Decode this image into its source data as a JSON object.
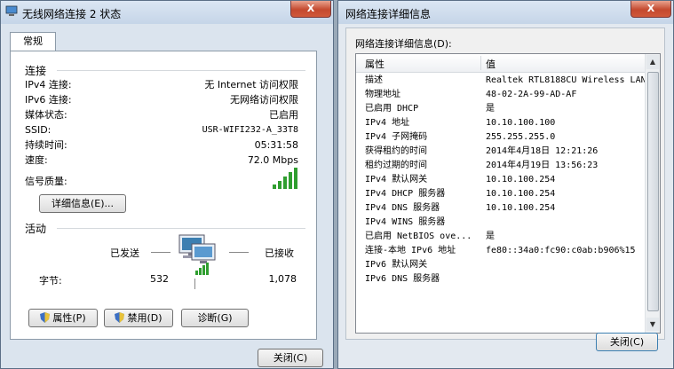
{
  "left_window": {
    "title": "无线网络连接 2 状态",
    "close_label": "X",
    "tab_label": "常规",
    "connection_heading": "连接",
    "connection_rows": [
      {
        "label": "IPv4 连接:",
        "value": "无 Internet 访问权限"
      },
      {
        "label": "IPv6 连接:",
        "value": "无网络访问权限"
      },
      {
        "label": "媒体状态:",
        "value": "已启用"
      },
      {
        "label": "SSID:",
        "value": "USR-WIFI232-A_33T8"
      },
      {
        "label": "持续时间:",
        "value": "05:31:58"
      },
      {
        "label": "速度:",
        "value": "72.0 Mbps"
      }
    ],
    "signal_label": "信号质量:",
    "signal_bars_lit": 5,
    "signal_bars_total": 5,
    "details_button": "详细信息(E)...",
    "activity_heading": "活动",
    "sent_label": "已发送",
    "received_label": "已接收",
    "bytes_label": "字节:",
    "bytes_sent": "532",
    "bytes_received": "1,078",
    "properties_button": "属性(P)",
    "disable_button": "禁用(D)",
    "diagnose_button": "诊断(G)",
    "close_button": "关闭(C)"
  },
  "right_window": {
    "title": "网络连接详细信息",
    "close_label": "X",
    "list_label": "网络连接详细信息(D):",
    "col_property": "属性",
    "col_value": "值",
    "rows": [
      {
        "prop": "描述",
        "value": "Realtek RTL8188CU Wireless LAN"
      },
      {
        "prop": "物理地址",
        "value": "48-02-2A-99-AD-AF"
      },
      {
        "prop": "已启用 DHCP",
        "value": "是"
      },
      {
        "prop": "IPv4 地址",
        "value": "10.10.100.100"
      },
      {
        "prop": "IPv4 子网掩码",
        "value": "255.255.255.0"
      },
      {
        "prop": "获得租约的时间",
        "value": "2014年4月18日 12:21:26"
      },
      {
        "prop": "租约过期的时间",
        "value": "2014年4月19日 13:56:23"
      },
      {
        "prop": "IPv4 默认网关",
        "value": "10.10.100.254"
      },
      {
        "prop": "IPv4 DHCP 服务器",
        "value": "10.10.100.254"
      },
      {
        "prop": "IPv4 DNS 服务器",
        "value": "10.10.100.254"
      },
      {
        "prop": "IPv4 WINS 服务器",
        "value": ""
      },
      {
        "prop": "已启用 NetBIOS ove...",
        "value": "是"
      },
      {
        "prop": "连接-本地 IPv6 地址",
        "value": "fe80::34a0:fc90:c0ab:b906%15"
      },
      {
        "prop": "IPv6 默认网关",
        "value": ""
      },
      {
        "prop": "IPv6 DNS 服务器",
        "value": ""
      }
    ],
    "close_button": "关闭(C)"
  },
  "colors": {
    "signal_green": "#2f9e2f",
    "accent_blue": "#3c7fb1"
  }
}
